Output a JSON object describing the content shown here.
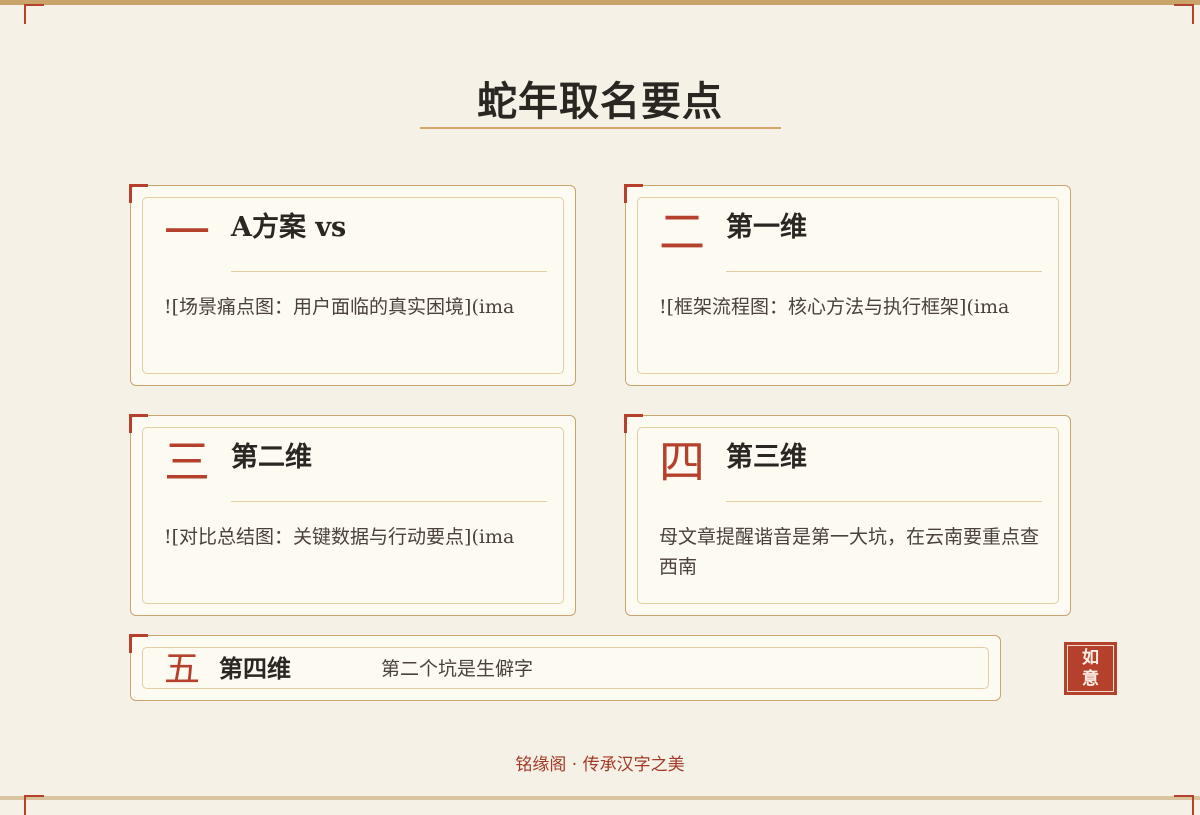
{
  "page": {
    "title": "蛇年取名要点",
    "footer": "铭缘阁 · 传承汉字之美",
    "seal": {
      "line1": "如",
      "line2": "意"
    }
  },
  "colors": {
    "accent_red": "#b5412c",
    "gold": "#c9a56f",
    "background": "#f6f1e7",
    "card": "#fdfaf2"
  },
  "cards": [
    {
      "num": "一",
      "heading": "A方案 vs",
      "body": "![场景痛点图：用户面临的真实困境](ima"
    },
    {
      "num": "二",
      "heading": "第一维",
      "body": "![框架流程图：核心方法与执行框架](ima"
    },
    {
      "num": "三",
      "heading": "第二维",
      "body": "![对比总结图：关键数据与行动要点](ima"
    },
    {
      "num": "四",
      "heading": "第三维",
      "body": "母文章提醒谐音是第一大坑，在云南要重点查西南"
    },
    {
      "num": "五",
      "heading": "第四维",
      "body": "第二个坑是生僻字"
    }
  ]
}
